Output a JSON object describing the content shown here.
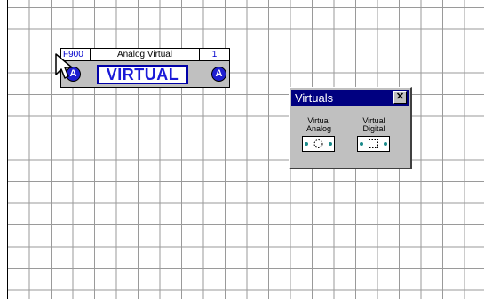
{
  "block": {
    "id": "F900",
    "type": "Analog Virtual",
    "number": "1",
    "label": "VIRTUAL",
    "badge_left": "A",
    "badge_right": "A"
  },
  "palette": {
    "title": "Virtuals",
    "close_glyph": "✕",
    "tools": [
      {
        "line1": "Virtual",
        "line2": "Analog",
        "icon": "analog-circle-icon"
      },
      {
        "line1": "Virtual",
        "line2": "Digital",
        "icon": "digital-square-icon"
      }
    ]
  },
  "colors": {
    "grid": "#9a9a9a",
    "block_face": "#c0c0c0",
    "accent_blue": "#1a1ad8",
    "titlebar": "#000080"
  }
}
